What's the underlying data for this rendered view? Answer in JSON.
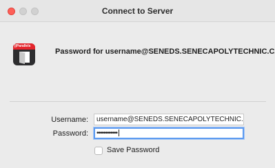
{
  "window": {
    "title": "Connect to Server"
  },
  "app": {
    "icon": "parallels-logo-icon",
    "brand_text": "||Parallels"
  },
  "prompt": {
    "text": "Password for username@SENEDS.SENECAPOLYTECHNIC.CA"
  },
  "form": {
    "username_label": "Username:",
    "username_value": "username@SENEDS.SENECAPOLYTECHNIC.CA",
    "password_label": "Password:",
    "password_mask": "••••••••••••",
    "save_password_label": "Save Password",
    "save_password_checked": false
  },
  "colors": {
    "close_button": "#fe5f57",
    "focus_ring": "#5b9af0",
    "brand_red": "#e4252c"
  }
}
